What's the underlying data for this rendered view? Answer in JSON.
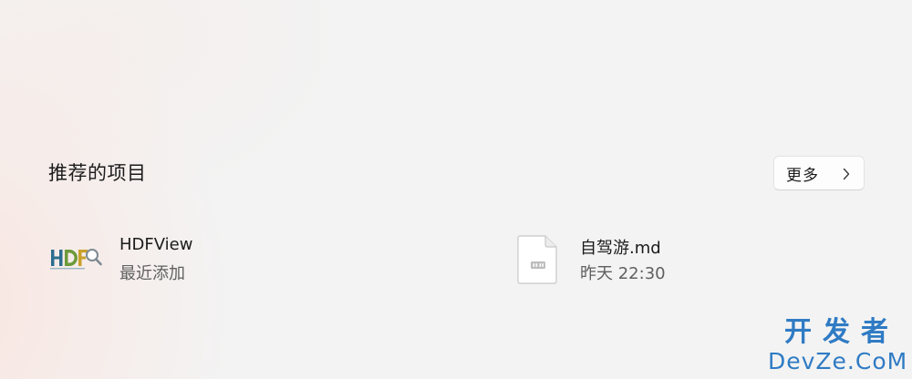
{
  "recommended": {
    "title": "推荐的项目",
    "more_button": {
      "label": "更多",
      "icon": "chevron-right-icon"
    },
    "items": [
      {
        "name": "HDFView",
        "meta": "最近添加",
        "icon": "hdfview-app-icon"
      },
      {
        "name": "自驾游.md",
        "meta": "昨天 22:30",
        "icon": "markdown-file-icon"
      }
    ]
  },
  "watermark": {
    "line1": "开发者",
    "line2": "DevZe.CoM"
  },
  "colors": {
    "background": "#f3f3f3",
    "text_primary": "#1b1b1b",
    "text_secondary": "#5f5f5f",
    "watermark": "#2f7bc4"
  }
}
